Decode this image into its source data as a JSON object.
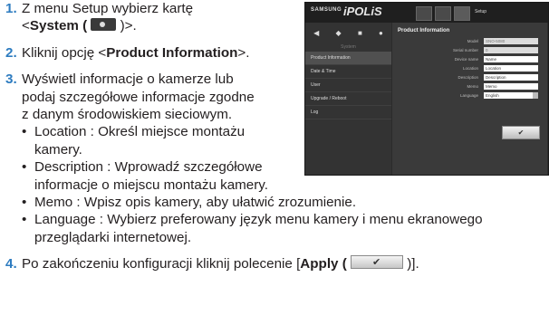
{
  "steps": {
    "s1": {
      "num": "1.",
      "line1": "Z menu Setup wybierz kartę",
      "open": "<",
      "bold": "System ( ",
      "close": " )>."
    },
    "s2": {
      "num": "2.",
      "pre": "Kliknij opcję <",
      "bold": "Product Information",
      "post": ">."
    },
    "s3": {
      "num": "3.",
      "line1": "Wyświetl informacje o kamerze lub",
      "line2": "podaj szczegółowe informacje zgodne",
      "line3": "z danym środowiskiem sieciowym."
    },
    "s4": {
      "num": "4.",
      "pre": "Po zakończeniu konfiguracji kliknij polecenie [",
      "bold": "Apply ( ",
      "close": " )]."
    }
  },
  "bullets": {
    "location": {
      "l1": "Location : Określ miejsce montażu",
      "l2": "kamery."
    },
    "description": {
      "l1": "Description : Wprowadź szczegółowe",
      "l2": "informacje o miejscu montażu kamery."
    },
    "memo": {
      "l1": "Memo : Wpisz opis kamery, aby ułatwić zrozumienie."
    },
    "language": {
      "l1": "Language : Wybierz preferowany język menu kamery i menu ekranowego",
      "l2": "przeglądarki internetowej."
    }
  },
  "shot": {
    "brand1": "SAMSUNG",
    "brand2": "iPOLiS",
    "setup": "Setup",
    "sys_label": "System",
    "menu": [
      "Product Information",
      "Date & Time",
      "User",
      "Upgrade / Reboot",
      "Log"
    ],
    "page_title": "Product Information",
    "fields": [
      {
        "label": "Model",
        "value": "SNO-5080",
        "ro": true
      },
      {
        "label": "Serial number",
        "value": "0",
        "ro": true
      },
      {
        "label": "Device name",
        "value": "Name",
        "ro": false
      },
      {
        "label": "Location",
        "value": "Location",
        "ro": false
      },
      {
        "label": "Description",
        "value": "Description",
        "ro": false
      },
      {
        "label": "Memo",
        "value": "Memo",
        "ro": false
      },
      {
        "label": "Language",
        "value": "English",
        "ro": false
      }
    ]
  }
}
